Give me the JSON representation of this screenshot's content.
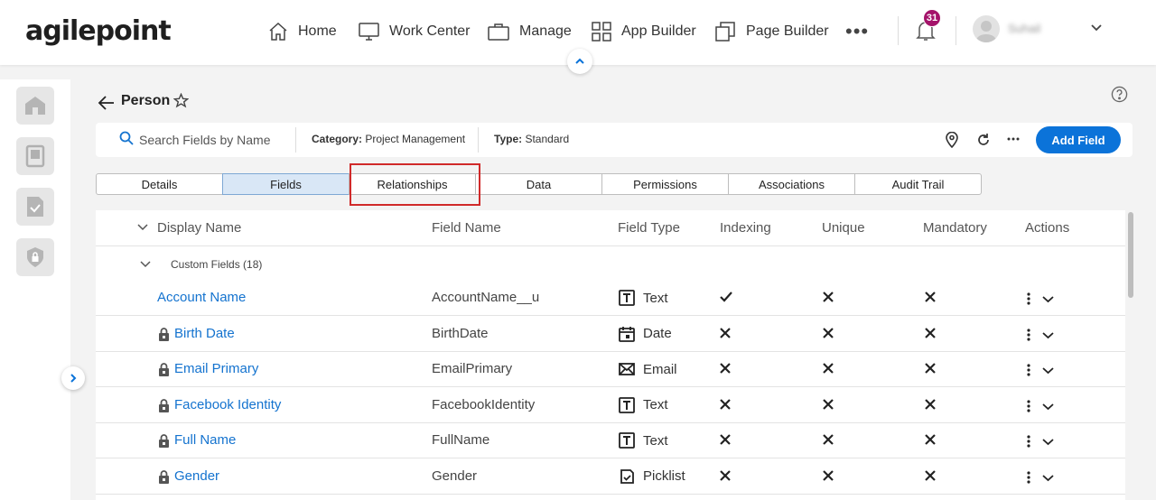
{
  "brand": {
    "logo": "agilepoint"
  },
  "nav": {
    "items": [
      {
        "label": "Home",
        "icon": "home-icon"
      },
      {
        "label": "Work Center",
        "icon": "monitor-icon"
      },
      {
        "label": "Manage",
        "icon": "briefcase-icon"
      },
      {
        "label": "App Builder",
        "icon": "grid-icon"
      },
      {
        "label": "Page Builder",
        "icon": "pages-icon"
      }
    ],
    "more": "•••",
    "notifications_count": "31",
    "username": "Suhail"
  },
  "page": {
    "title": "Person",
    "search": {
      "placeholder": "Search Fields by Name",
      "value": ""
    },
    "category_label": "Category:",
    "category_value": "Project Management",
    "type_label": "Type:",
    "type_value": "Standard",
    "add_field_label": "Add Field"
  },
  "tabs": [
    {
      "label": "Details"
    },
    {
      "label": "Fields",
      "active": true
    },
    {
      "label": "Relationships",
      "highlighted": true
    },
    {
      "label": "Data"
    },
    {
      "label": "Permissions"
    },
    {
      "label": "Associations"
    },
    {
      "label": "Audit Trail"
    }
  ],
  "table": {
    "headers": {
      "display_name": "Display Name",
      "field_name": "Field Name",
      "field_type": "Field Type",
      "indexing": "Indexing",
      "unique": "Unique",
      "mandatory": "Mandatory",
      "actions": "Actions"
    },
    "group_label": "Custom Fields (18)",
    "rows": [
      {
        "display": "Account Name",
        "field": "AccountName__u",
        "type": "Text",
        "type_icon": "text-type-icon",
        "locked": false,
        "indexing": "check",
        "unique": "cross",
        "mandatory": "cross"
      },
      {
        "display": "Birth Date",
        "field": "BirthDate",
        "type": "Date",
        "type_icon": "calendar-icon",
        "locked": true,
        "indexing": "cross",
        "unique": "cross",
        "mandatory": "cross"
      },
      {
        "display": "Email Primary",
        "field": "EmailPrimary",
        "type": "Email",
        "type_icon": "envelope-icon",
        "locked": true,
        "indexing": "cross",
        "unique": "cross",
        "mandatory": "cross"
      },
      {
        "display": "Facebook Identity",
        "field": "FacebookIdentity",
        "type": "Text",
        "type_icon": "text-type-icon",
        "locked": true,
        "indexing": "cross",
        "unique": "cross",
        "mandatory": "cross"
      },
      {
        "display": "Full Name",
        "field": "FullName",
        "type": "Text",
        "type_icon": "text-type-icon",
        "locked": true,
        "indexing": "cross",
        "unique": "cross",
        "mandatory": "cross"
      },
      {
        "display": "Gender",
        "field": "Gender",
        "type": "Picklist",
        "type_icon": "picklist-icon",
        "locked": true,
        "indexing": "cross",
        "unique": "cross",
        "mandatory": "cross"
      }
    ]
  },
  "colors": {
    "accent": "#0b73d9",
    "link": "#1473cf",
    "badge": "#a4136a",
    "highlight": "#d02a2a"
  }
}
